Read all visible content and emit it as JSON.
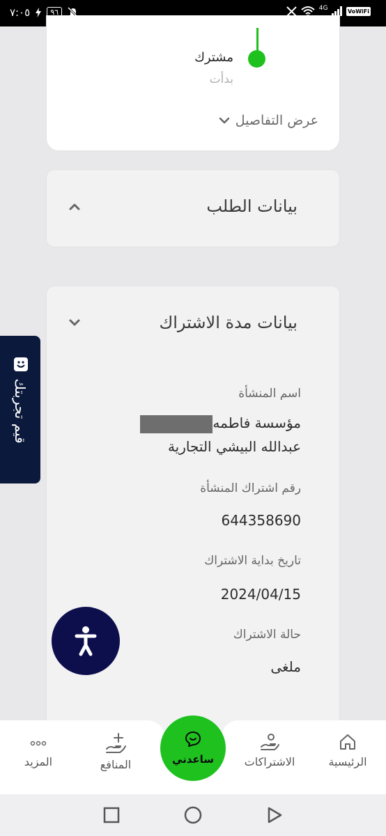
{
  "status_bar": {
    "time": "٧:٠٥",
    "battery": "٩٦",
    "network": "4G",
    "wifi_calling": "VoWiFi"
  },
  "timeline": {
    "status": "مشترك",
    "sub_status": "بدأت",
    "details_link": "عرض التفاصيل"
  },
  "sections": {
    "order_data": {
      "title": "بيانات الطلب"
    },
    "subscription_period": {
      "title": "بيانات مدة الاشتراك"
    }
  },
  "fields": [
    {
      "label": "اسم المنشأة",
      "value_line1": "مؤسسة فاطمه",
      "value_line2": "عبدالله البيشي التجارية"
    },
    {
      "label": "رقم اشتراك المنشأة",
      "value": "644358690"
    },
    {
      "label": "تاريخ بداية الاشتراك",
      "value": "2024/04/15"
    },
    {
      "label": "حالة الاشتراك",
      "value": "ملغى"
    }
  ],
  "feedback_tab": {
    "label": "قيم تجربتك"
  },
  "bottom_nav": {
    "home": "الرئيسية",
    "subscriptions": "الاشتراكات",
    "help": "ساعدني",
    "benefits": "المنافع",
    "more": "المزيد"
  },
  "colors": {
    "accent": "#1fc11f",
    "navy": "#0b1a3c",
    "a11y": "#0d0f4d"
  },
  "icons": [
    "home-icon",
    "hand-user-icon",
    "chat-icon",
    "hand-plus-icon",
    "dots-icon",
    "accessibility-icon",
    "smile-icon",
    "chevron-up-icon",
    "chevron-down-icon"
  ]
}
